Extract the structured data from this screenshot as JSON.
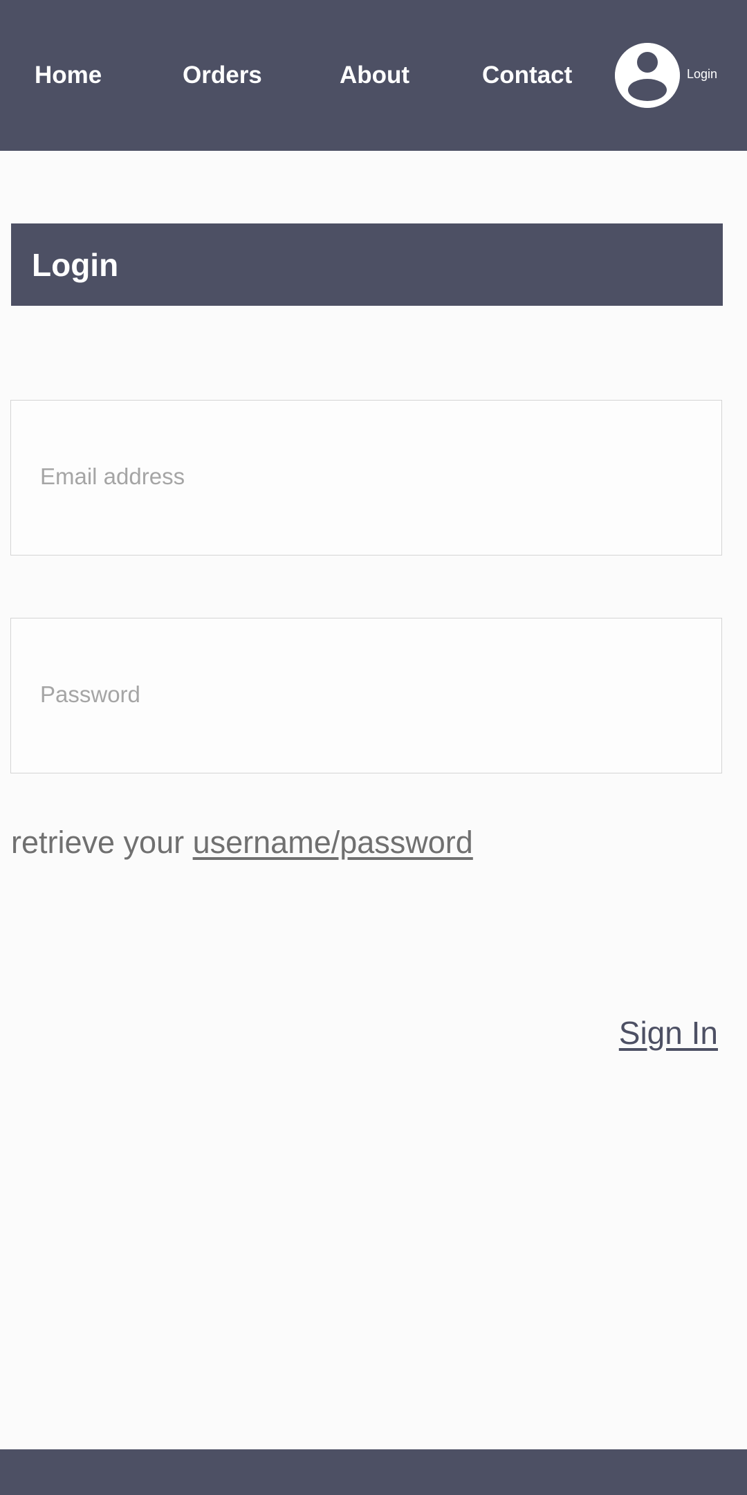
{
  "nav": {
    "items": [
      {
        "label": "Home"
      },
      {
        "label": "Orders"
      },
      {
        "label": "About"
      },
      {
        "label": "Contact"
      }
    ],
    "avatar_icon": "user-circle-icon",
    "login_label": "Login"
  },
  "header": {
    "title": "Login"
  },
  "form": {
    "email": {
      "placeholder": "Email address",
      "value": ""
    },
    "password": {
      "placeholder": "Password",
      "value": ""
    },
    "retrieve_prefix": "retrieve your ",
    "retrieve_link": "username/password",
    "sign_in_label": "Sign In"
  },
  "colors": {
    "primary": "#4d5064",
    "background": "#fbfbfb",
    "placeholder": "#a5a5a5",
    "muted_text": "#707070"
  }
}
